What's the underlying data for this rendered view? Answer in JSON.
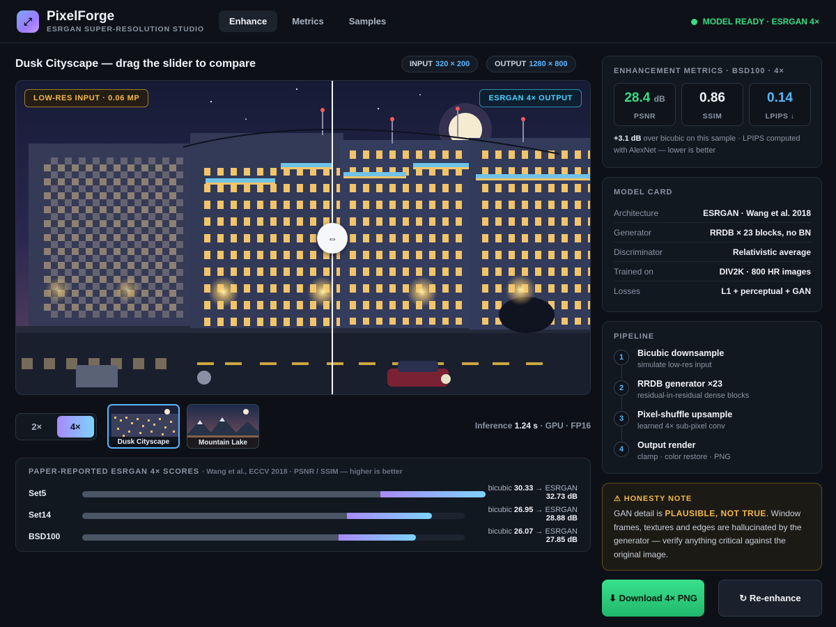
{
  "header": {
    "logo_glyph": "⤢",
    "brand": "PixelForge",
    "subtitle": "ESRGAN SUPER-RESOLUTION STUDIO",
    "tabs": [
      {
        "label": "Enhance",
        "active": true
      },
      {
        "label": "Metrics",
        "active": false
      },
      {
        "label": "Samples",
        "active": false
      }
    ],
    "status": "MODEL READY · ESRGAN 4×",
    "status_color": "#3ddc84"
  },
  "compare": {
    "title": "Dusk Cityscape — drag the slider to compare",
    "input_label": "INPUT",
    "input_res": "320 × 200",
    "output_label": "OUTPUT",
    "output_res": "1280 × 800",
    "left_tag": "LOW-RES INPUT · 0.06 MP",
    "right_tag": "ESRGAN 4× OUTPUT",
    "slider_icon": "⇔",
    "slider_position": 0.55
  },
  "controls": {
    "scales": [
      {
        "label": "2×",
        "active": false
      },
      {
        "label": "4×",
        "active": true
      }
    ],
    "samples": [
      {
        "label": "Dusk Cityscape",
        "active": true
      },
      {
        "label": "Mountain Lake",
        "active": false
      }
    ],
    "inference_prefix": "Inference",
    "inference_time": "1.24 s",
    "inference_suffix": "· GPU · FP16"
  },
  "scores": {
    "title": "PAPER-REPORTED ESRGAN 4× SCORES",
    "subtitle": "· Wang et al., ECCV 2018 · PSNR / SSIM — higher is better",
    "rows": [
      {
        "name": "Set5",
        "bicubic_label": "bicubic",
        "bicubic": "30.33",
        "arrow_label": "→ ESRGAN",
        "esrgan": "32.73 dB",
        "bicubic_value": 30.33,
        "esrgan_value": 32.73
      },
      {
        "name": "Set14",
        "bicubic_label": "bicubic",
        "bicubic": "26.95",
        "arrow_label": "→ ESRGAN",
        "esrgan": "28.88 dB",
        "bicubic_value": 26.95,
        "esrgan_value": 28.88
      },
      {
        "name": "BSD100",
        "bicubic_label": "bicubic",
        "bicubic": "26.07",
        "arrow_label": "→ ESRGAN",
        "esrgan": "27.85 dB",
        "bicubic_value": 26.07,
        "esrgan_value": 27.85
      }
    ]
  },
  "metrics": {
    "title": "ENHANCEMENT METRICS · BSD100 · 4×",
    "cards": [
      {
        "value": "28.4",
        "unit": "dB",
        "label": "PSNR",
        "color": "#3ddc84"
      },
      {
        "value": "0.86",
        "unit": "",
        "label": "SSIM",
        "color": "#f0f3f6"
      },
      {
        "value": "0.14",
        "unit": "",
        "label": "LPIPS ↓",
        "color": "#58b6ff"
      }
    ],
    "note_bold": "+3.1 dB",
    "note_rest": " over bicubic on this sample · LPIPS computed with AlexNet — lower is better"
  },
  "model_card": {
    "title": "MODEL CARD",
    "rows": [
      {
        "key": "Architecture",
        "value": "ESRGAN · Wang et al. 2018"
      },
      {
        "key": "Generator",
        "value": "RRDB × 23 blocks, no BN"
      },
      {
        "key": "Discriminator",
        "value": "Relativistic average"
      },
      {
        "key": "Trained on",
        "value": "DIV2K · 800 HR images"
      },
      {
        "key": "Losses",
        "value": "L1 + perceptual + GAN"
      }
    ]
  },
  "pipeline": {
    "title": "PIPELINE",
    "steps": [
      {
        "num": "1",
        "title": "Bicubic downsample",
        "sub": "simulate low-res input"
      },
      {
        "num": "2",
        "title": "RRDB generator ×23",
        "sub": "residual-in-residual dense blocks"
      },
      {
        "num": "3",
        "title": "Pixel-shuffle upsample",
        "sub": "learned 4× sub-pixel conv"
      },
      {
        "num": "4",
        "title": "Output render",
        "sub": "clamp · color restore · PNG"
      }
    ]
  },
  "honesty": {
    "icon": "⚠",
    "title": "HONESTY NOTE",
    "text_a": "GAN detail is ",
    "highlight": "PLAUSIBLE, NOT TRUE",
    "text_b": ". Window frames, textures and edges are hallucinated by the generator — verify anything critical against the original image."
  },
  "actions": {
    "download_icon": "⬇",
    "download": "Download 4× PNG",
    "reenhance_icon": "↻",
    "reenhance": "Re-enhance"
  }
}
